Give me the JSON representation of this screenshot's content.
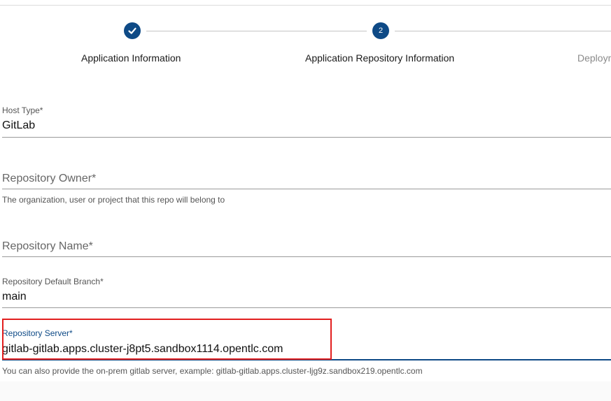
{
  "stepper": {
    "steps": [
      {
        "label": "Application Information",
        "status": "completed",
        "icon": "check-icon"
      },
      {
        "label": "Application Repository Information",
        "status": "active",
        "number": "2"
      },
      {
        "label": "Deploym",
        "status": "upcoming"
      }
    ]
  },
  "form": {
    "host_type": {
      "label": "Host Type*",
      "value": "GitLab"
    },
    "repository_owner": {
      "placeholder": "Repository Owner*",
      "helper": "The organization, user or project that this repo will belong to"
    },
    "repository_name": {
      "placeholder": "Repository Name*"
    },
    "repository_default_branch": {
      "label": "Repository Default Branch*",
      "value": "main"
    },
    "repository_server": {
      "label": "Repository Server*",
      "value": "gitlab-gitlab.apps.cluster-j8pt5.sandbox1114.opentlc.com",
      "helper": "You can also provide the on-prem gitlab server, example: gitlab-gitlab.apps.cluster-ljg9z.sandbox219.opentlc.com"
    }
  },
  "colors": {
    "accent": "#0e4a86",
    "highlight": "#e21f1f"
  }
}
